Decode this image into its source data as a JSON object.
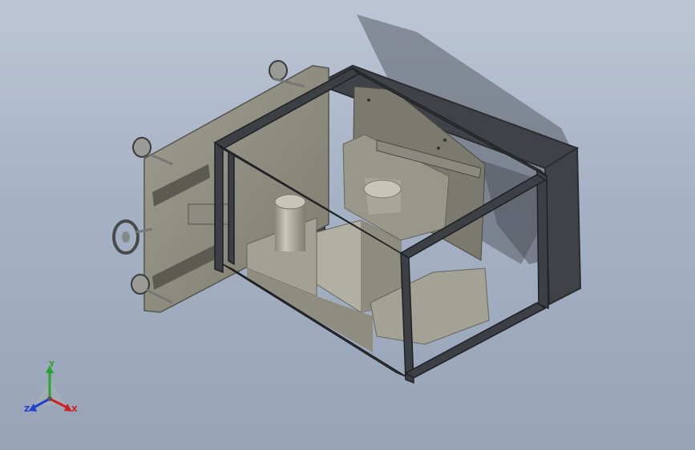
{
  "viewport": {
    "background_top": "#bcc6d6",
    "background_bottom": "#97a4b8"
  },
  "triad": {
    "x_label": "X",
    "y_label": "Y",
    "z_label": "Z",
    "x_color": "#d02020",
    "y_color": "#2aa52a",
    "z_color": "#2040d0"
  },
  "model": {
    "frame_color": "#3a3d40",
    "plate_color": "#8a887a",
    "block_color": "#9e9c8e"
  }
}
